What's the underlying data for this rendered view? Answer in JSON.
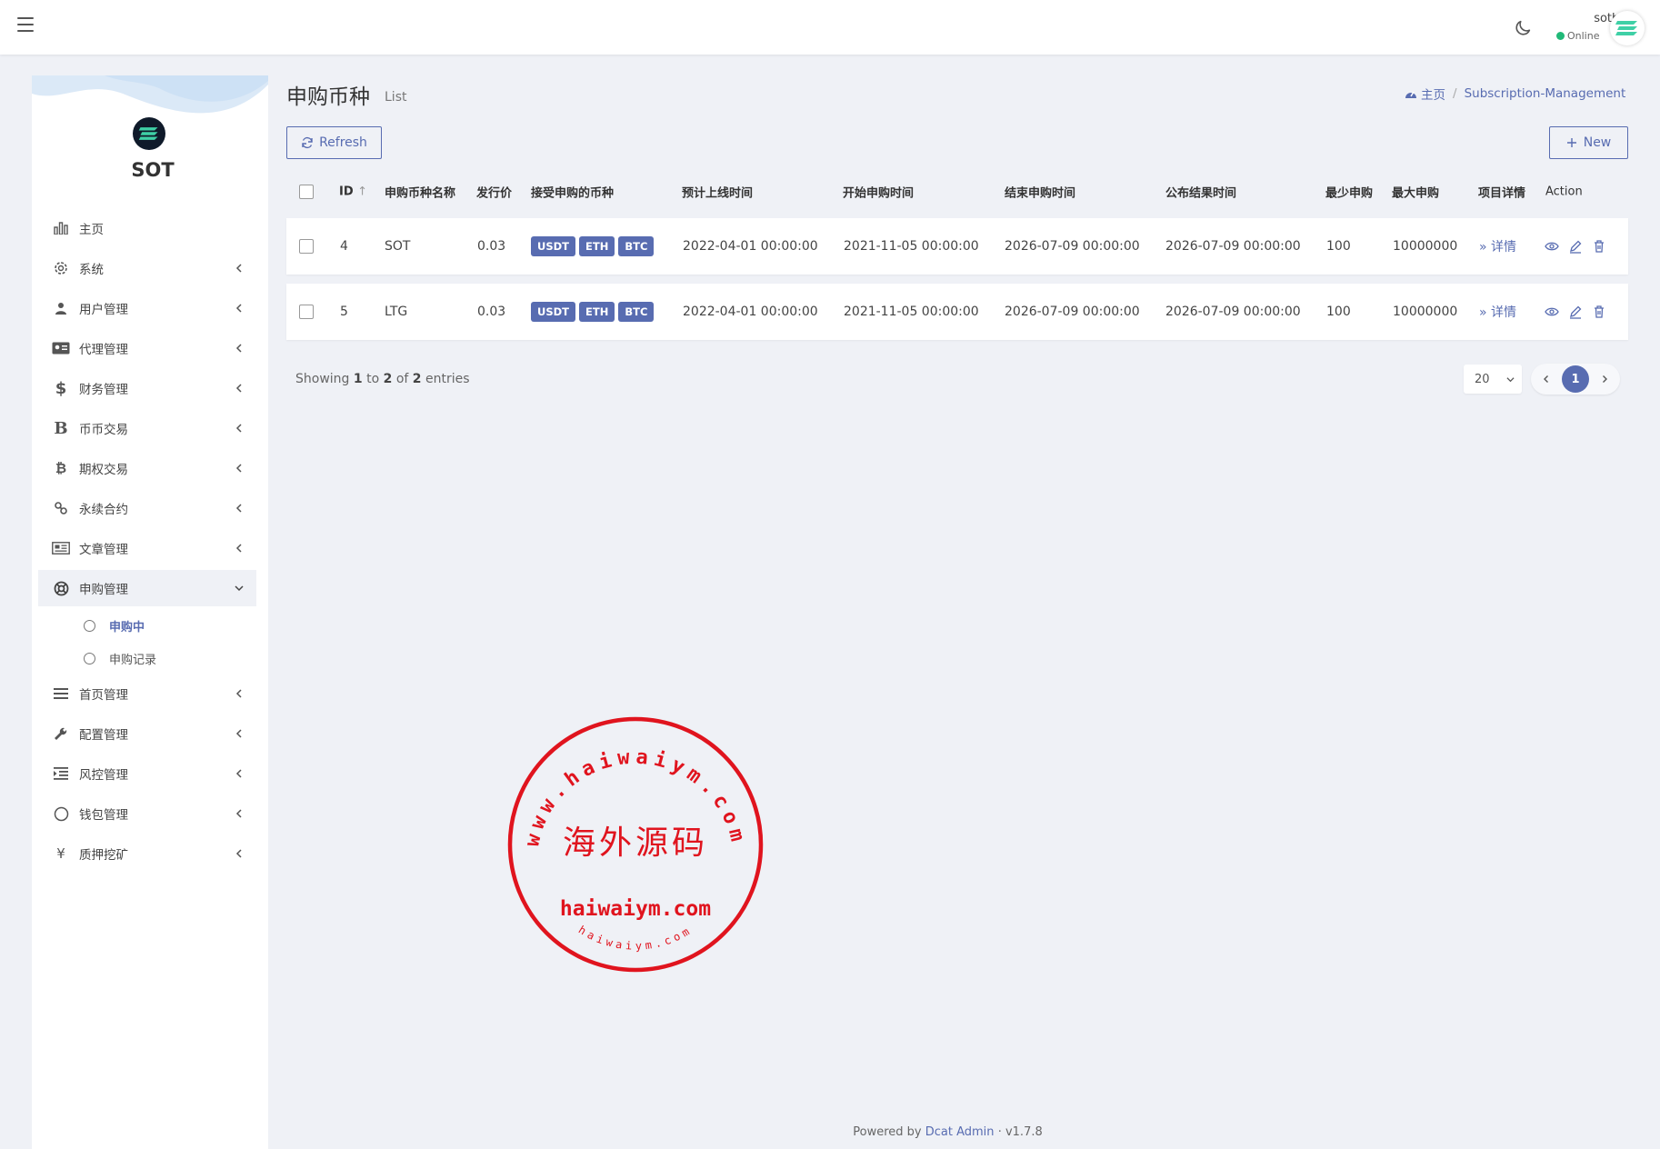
{
  "topbar": {
    "user_name": "sotbit",
    "user_status": "Online",
    "colors": {
      "online": "#21b978"
    }
  },
  "sidebar": {
    "brand": "SOT",
    "menu": [
      {
        "label": "主页",
        "icon": "bar-chart-icon",
        "has_children": false
      },
      {
        "label": "系统",
        "icon": "gear-icon",
        "has_children": true
      },
      {
        "label": "用户管理",
        "icon": "users-icon",
        "has_children": true
      },
      {
        "label": "代理管理",
        "icon": "id-card-icon",
        "has_children": true
      },
      {
        "label": "财务管理",
        "icon": "dollar-icon",
        "has_children": true
      },
      {
        "label": "币币交易",
        "icon": "b-letter-icon",
        "has_children": true
      },
      {
        "label": "期权交易",
        "icon": "bitcoin-icon",
        "has_children": true
      },
      {
        "label": "永续合约",
        "icon": "link-icon",
        "has_children": true
      },
      {
        "label": "文章管理",
        "icon": "newspaper-icon",
        "has_children": true
      },
      {
        "label": "申购管理",
        "icon": "lifebuoy-icon",
        "has_children": true,
        "expanded": true
      },
      {
        "label": "首页管理",
        "icon": "bars-icon",
        "has_children": true
      },
      {
        "label": "配置管理",
        "icon": "wrench-icon",
        "has_children": true
      },
      {
        "label": "风控管理",
        "icon": "indent-icon",
        "has_children": true
      },
      {
        "label": "钱包管理",
        "icon": "circle-icon",
        "has_children": true
      },
      {
        "label": "质押挖矿",
        "icon": "yen-icon",
        "has_children": true
      }
    ],
    "submenu": [
      {
        "label": "申购中",
        "active": true
      },
      {
        "label": "申购记录",
        "active": false
      }
    ]
  },
  "page": {
    "title": "申购币种",
    "subtitle": "List",
    "breadcrumb_home": "主页",
    "breadcrumb_current": "Subscription-Management",
    "refresh_label": "Refresh",
    "new_label": "New"
  },
  "table": {
    "columns": [
      "ID",
      "申购币种名称",
      "发行价",
      "接受申购的币种",
      "预计上线时间",
      "开始申购时间",
      "结束申购时间",
      "公布结果时间",
      "最少申购",
      "最大申购",
      "项目详情",
      "Action"
    ],
    "rows": [
      {
        "id": "4",
        "name": "SOT",
        "price": "0.03",
        "coins": [
          "USDT",
          "ETH",
          "BTC"
        ],
        "online_time": "2022-04-01 00:00:00",
        "start_time": "2021-11-05 00:00:00",
        "end_time": "2026-07-09 00:00:00",
        "result_time": "2026-07-09 00:00:00",
        "min": "100",
        "max": "10000000",
        "detail": "详情"
      },
      {
        "id": "5",
        "name": "LTG",
        "price": "0.03",
        "coins": [
          "USDT",
          "ETH",
          "BTC"
        ],
        "online_time": "2022-04-01 00:00:00",
        "start_time": "2021-11-05 00:00:00",
        "end_time": "2026-07-09 00:00:00",
        "result_time": "2026-07-09 00:00:00",
        "min": "100",
        "max": "10000000",
        "detail": "详情"
      }
    ]
  },
  "pagination": {
    "showing_prefix": "Showing",
    "from": "1",
    "to_word": "to",
    "to": "2",
    "of_word": "of",
    "total": "2",
    "entries_word": "entries",
    "per_page": "20",
    "current_page": "1"
  },
  "stamp": {
    "ring_text": "www.haiwaiym.com",
    "center_text": "海外源码",
    "domain_text": "haiwaiym.com",
    "bottom_small": "haiwaiym.com",
    "color": "#e0141e"
  },
  "footer": {
    "powered_by": "Powered by",
    "link": "Dcat Admin",
    "dot": "·",
    "version": "v1.7.8"
  },
  "colors": {
    "accent": "#586cb1",
    "background": "#eff1f6"
  }
}
